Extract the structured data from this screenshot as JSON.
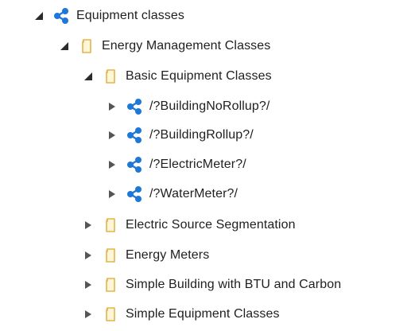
{
  "tree": {
    "root": {
      "label": "Equipment classes",
      "icon": "share-network-icon",
      "expanded": true
    },
    "energy_management": {
      "label": "Energy Management Classes",
      "icon": "folder-icon",
      "expanded": true
    },
    "basic_equipment": {
      "label": "Basic Equipment Classes",
      "icon": "folder-icon",
      "expanded": true
    },
    "basic_children": [
      {
        "label": "/?BuildingNoRollup?/",
        "icon": "share-network-icon",
        "expanded": false
      },
      {
        "label": "/?BuildingRollup?/",
        "icon": "share-network-icon",
        "expanded": false
      },
      {
        "label": "/?ElectricMeter?/",
        "icon": "share-network-icon",
        "expanded": false
      },
      {
        "label": "/?WaterMeter?/",
        "icon": "share-network-icon",
        "expanded": false
      }
    ],
    "siblings": [
      {
        "label": "Electric Source Segmentation",
        "icon": "folder-icon",
        "expanded": false
      },
      {
        "label": "Energy Meters",
        "icon": "folder-icon",
        "expanded": false
      },
      {
        "label": "Simple Building with BTU and Carbon",
        "icon": "folder-icon",
        "expanded": false
      },
      {
        "label": "Simple Equipment Classes",
        "icon": "folder-icon",
        "expanded": false
      }
    ]
  },
  "colors": {
    "text": "#1f1f1f",
    "share_icon": "#1e78d6",
    "folder_outline": "#e2b54a",
    "folder_fill": "#fff6d9",
    "expanded_arrow": "#2b2b2b",
    "collapsed_arrow": "#555555"
  }
}
